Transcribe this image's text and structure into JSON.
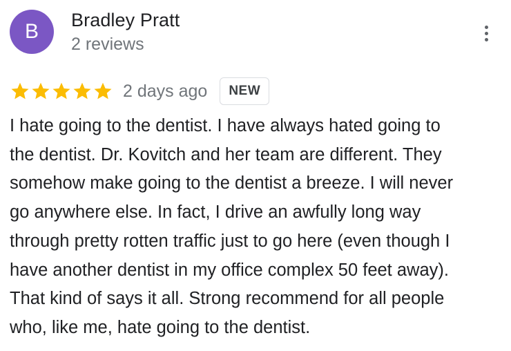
{
  "author": {
    "avatar_letter": "B",
    "avatar_color": "#7b57c4",
    "name": "Bradley Pratt",
    "review_count_text": "2 reviews"
  },
  "menu": {
    "icon": "more-vert-icon"
  },
  "rating": {
    "stars": 5,
    "max_stars": 5,
    "star_color": "#fbbc04",
    "time_text": "2 days ago",
    "badge_text": "NEW"
  },
  "review": {
    "lines": [
      "I hate going to the dentist. I have always hated going to",
      "the dentist. Dr. Kovitch and her team are different. They",
      "somehow make going to the dentist a breeze. I will never",
      "go anywhere else. In fact, I drive an awfully long way",
      "through pretty rotten traffic just to go here (even though I",
      "have another dentist in my office complex 50 feet away).",
      "That kind of says it all. Strong recommend for all people",
      "who, like me, hate going to the dentist."
    ]
  }
}
